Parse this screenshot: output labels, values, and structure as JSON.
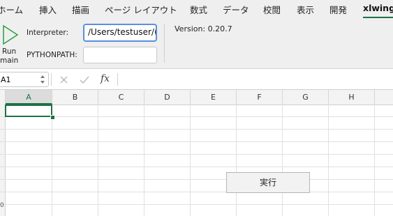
{
  "ribbon_tabs": [
    {
      "label": "ホーム"
    },
    {
      "label": "挿入"
    },
    {
      "label": "描画"
    },
    {
      "label": "ページ レイアウト"
    },
    {
      "label": "数式"
    },
    {
      "label": "データ"
    },
    {
      "label": "校閲"
    },
    {
      "label": "表示"
    },
    {
      "label": "開発"
    },
    {
      "label": "xlwings"
    }
  ],
  "active_tab": "xlwings",
  "ribbon": {
    "run_main_label_line1": "Run",
    "run_main_label_line2": "main",
    "interpreter_label": "Interpreter:",
    "interpreter_value": "/Users/testuser/(",
    "pythonpath_label": "PYTHONPATH:",
    "pythonpath_value": "",
    "version_text": "Version: 0.20.7"
  },
  "formula_bar": {
    "name_box": "A1",
    "cancel_icon": "x-icon",
    "confirm_icon": "check-icon",
    "fx_label": "fx",
    "formula_value": ""
  },
  "columns": [
    "A",
    "B",
    "C",
    "D",
    "E",
    "F",
    "G",
    "H"
  ],
  "selected_cell": "A1",
  "sheet_button": {
    "label": "実行"
  },
  "row_clip_label": "0",
  "colors": {
    "accent": "#1e7145",
    "focus_ring": "#5b8fde",
    "ribbon_bg": "#efefef"
  }
}
